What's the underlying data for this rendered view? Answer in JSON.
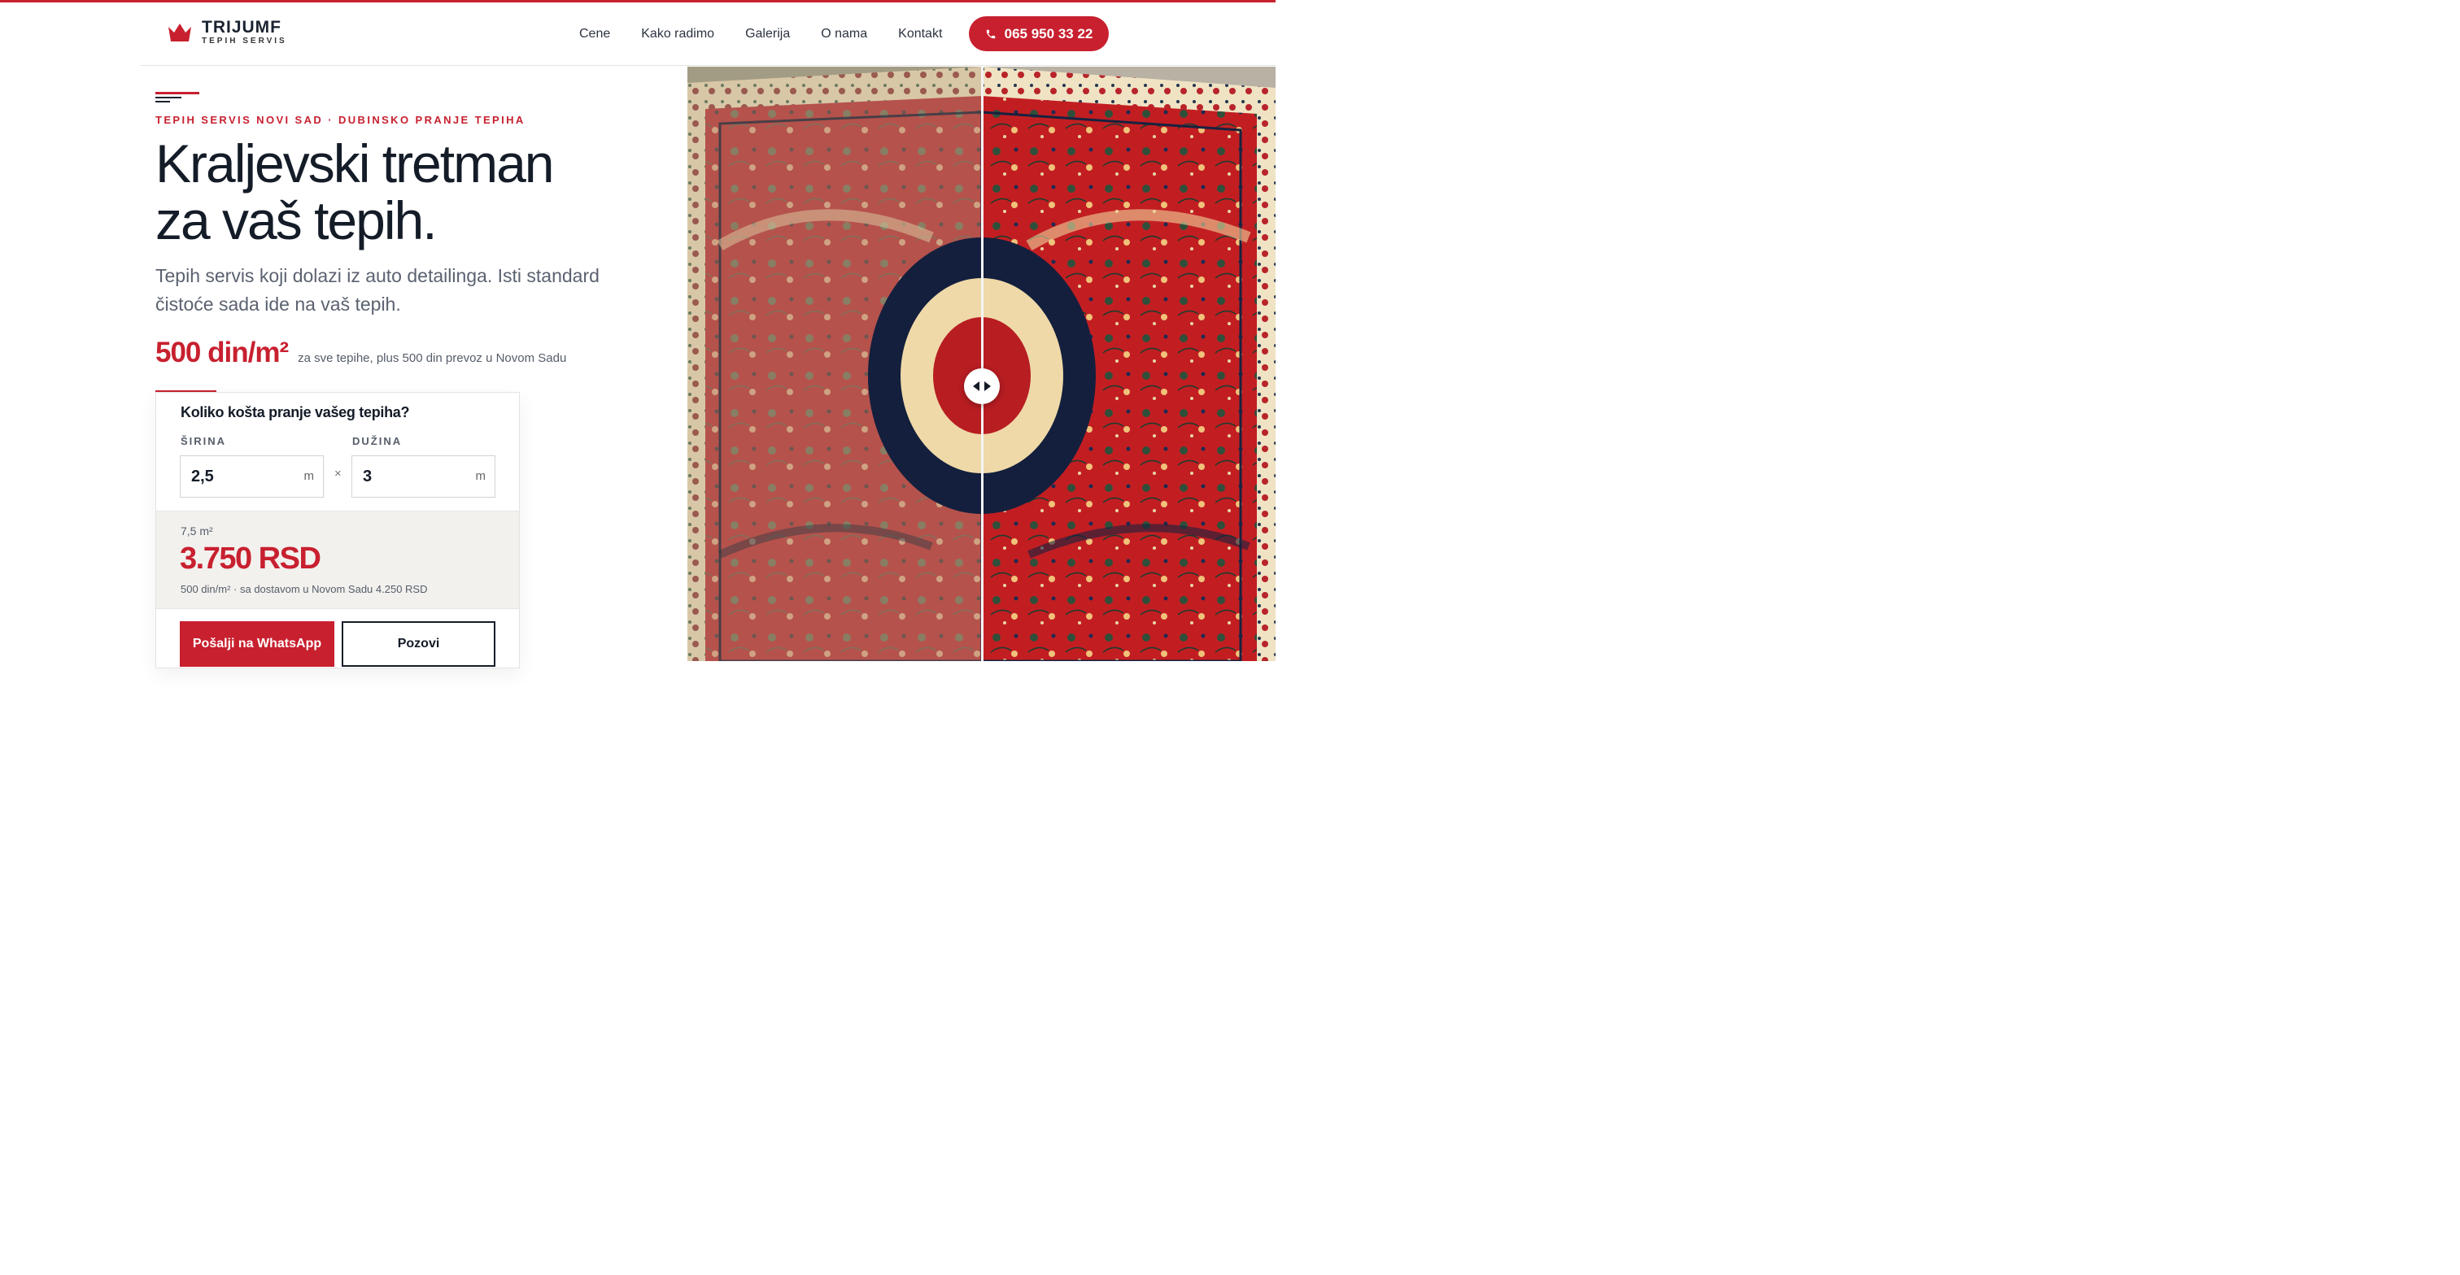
{
  "brand": {
    "name": "TRIJUMF",
    "tagline": "TEPIH SERVIS",
    "accent": "#c8202f",
    "icon": "crown-icon"
  },
  "nav": {
    "items": [
      "Cene",
      "Kako radimo",
      "Galerija",
      "O nama",
      "Kontakt"
    ],
    "phone": "065 950 33 22",
    "phone_icon": "phone-icon"
  },
  "hero": {
    "eyebrow": "TEPIH SERVIS NOVI SAD · DUBINSKO PRANJE TEPIHA",
    "headline_line1": "Kraljevski tretman",
    "headline_line2": "za vaš tepih.",
    "lead": "Tepih servis koji dolazi iz auto detailinga. Isti standard čistoće sada ide na vaš tepih.",
    "price": "500 din/m²",
    "price_note": "za sve tepihe, plus 500 din prevoz u Novom Sadu"
  },
  "calculator": {
    "title": "Koliko košta pranje vašeg tepiha?",
    "width_label": "ŠIRINA",
    "width_value": "2,5",
    "length_label": "DUŽINA",
    "length_value": "3",
    "unit": "m",
    "times": "×",
    "area": "7,5 m²",
    "total": "3.750 RSD",
    "total_note": "500 din/m² · sa dostavom u Novom Sadu 4.250 RSD",
    "whatsapp_label": "Pošalji na WhatsApp",
    "call_label": "Pozovi"
  },
  "compare": {
    "before_color": "#b5524c",
    "after_color": "#c21e22",
    "handle_icon": "left-right-arrows-icon"
  }
}
